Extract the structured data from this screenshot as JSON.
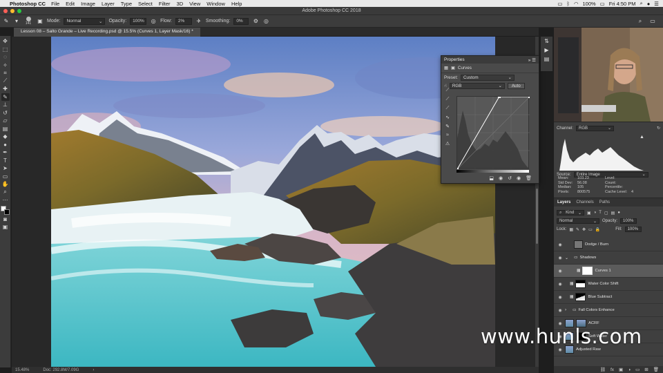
{
  "menubar": {
    "app": "Photoshop CC",
    "items": [
      "File",
      "Edit",
      "Image",
      "Layer",
      "Type",
      "Select",
      "Filter",
      "3D",
      "View",
      "Window",
      "Help"
    ],
    "battery": "100%",
    "clock": "Fri 4:50 PM"
  },
  "window": {
    "title": "Adobe Photoshop CC 2018"
  },
  "options": {
    "brush_size": "141",
    "mode_label": "Mode:",
    "mode_value": "Normal",
    "opacity_label": "Opacity:",
    "opacity_value": "100%",
    "flow_label": "Flow:",
    "flow_value": "2%",
    "smoothing_label": "Smoothing:",
    "smoothing_value": "0%"
  },
  "document": {
    "tab_title": "Lesson 08 – Salto Grande – Live Recording.psd @ 15.5% (Curves 1, Layer Mask/16) *"
  },
  "status": {
    "zoom": "15.48%",
    "doc": "Doc: 292.8M/7.09G"
  },
  "properties": {
    "panel_title": "Properties",
    "adjustment_name": "Curves",
    "preset_label": "Preset:",
    "preset_value": "Custom",
    "channel_value": "RGB",
    "auto_label": "Auto",
    "curve_points": [
      [
        0,
        0
      ],
      [
        0.58,
        1
      ],
      [
        1,
        1
      ]
    ]
  },
  "histogram": {
    "channel_label": "Channel:",
    "channel_value": "RGB",
    "source_label": "Source:",
    "source_value": "Entire Image",
    "stats": [
      [
        "Mean:",
        "103.23",
        "Level:",
        ""
      ],
      [
        "Std Dev:",
        "56.08",
        "Count:",
        ""
      ],
      [
        "Median:",
        "105",
        "Percentile:",
        ""
      ],
      [
        "Pixels:",
        "800575",
        "Cache Level:",
        "4"
      ]
    ]
  },
  "layers": {
    "tabs": [
      "Layers",
      "Channels",
      "Paths"
    ],
    "kind_label": "Kind",
    "blend_mode": "Normal",
    "opacity_label": "Opacity:",
    "opacity_value": "100%",
    "lock_label": "Lock:",
    "fill_label": "Fill:",
    "fill_value": "100%",
    "items": [
      {
        "name": "Dodge / Burn"
      },
      {
        "name": "Shadows"
      },
      {
        "name": "Curves 1"
      },
      {
        "name": "Water Color Shift"
      },
      {
        "name": "Blue Subtract"
      },
      {
        "name": "Fall Colors Enhance"
      },
      {
        "name": "ACRF"
      },
      {
        "name": "Soft Water"
      },
      {
        "name": "Adjusted Raw"
      }
    ]
  },
  "watermark": "www.hunls.com",
  "colors": {
    "accent_red": "#ff5f57",
    "accent_yellow": "#febc2e",
    "accent_green": "#28c840",
    "panel": "#3f3f3f"
  }
}
